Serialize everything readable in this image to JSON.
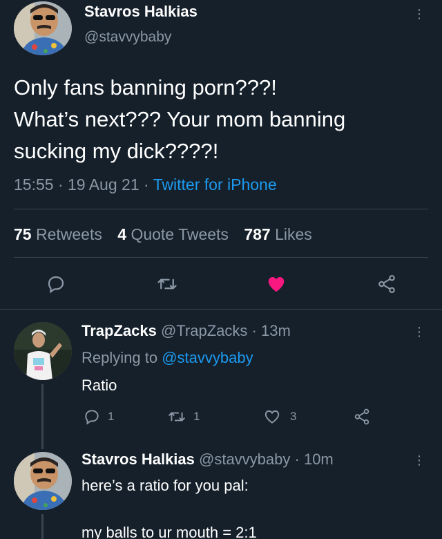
{
  "main_tweet": {
    "author_name": "Stavros Halkias",
    "author_handle": "@stavvybaby",
    "text_line1": "Only fans banning porn???!",
    "text_line2": "What’s next??? Your mom banning",
    "text_line3": "sucking my dick????!",
    "time": "15:55",
    "date": "19 Aug 21",
    "source": "Twitter for iPhone",
    "sep": " · ",
    "retweets_count": "75",
    "retweets_label": "Retweets",
    "quotes_count": "4",
    "quotes_label": "Quote Tweets",
    "likes_count": "787",
    "likes_label": "Likes",
    "liked": true,
    "like_color": "#f91880"
  },
  "reply1": {
    "author_name": "TrapZacks",
    "author_handle": "@TrapZacks",
    "age": "· 13m",
    "replying_prefix": "Replying to",
    "replying_handle": "@stavvybaby",
    "text": "Ratio",
    "reply_count": "1",
    "retweet_count": "1",
    "like_count": "3"
  },
  "reply2": {
    "author_name": "Stavros Halkias",
    "author_handle": "@stavvybaby",
    "age": "· 10m",
    "text_line1": "here’s a ratio for you pal:",
    "text_line2": "my balls to ur mouth = 2:1"
  },
  "icons": {
    "more": "more-vertical-icon",
    "reply": "reply-icon",
    "retweet": "retweet-icon",
    "like": "heart-icon",
    "share": "share-icon"
  },
  "colors": {
    "background": "#15202b",
    "muted": "#8b98a5",
    "link": "#1d9bf0",
    "divider": "#38444d"
  }
}
